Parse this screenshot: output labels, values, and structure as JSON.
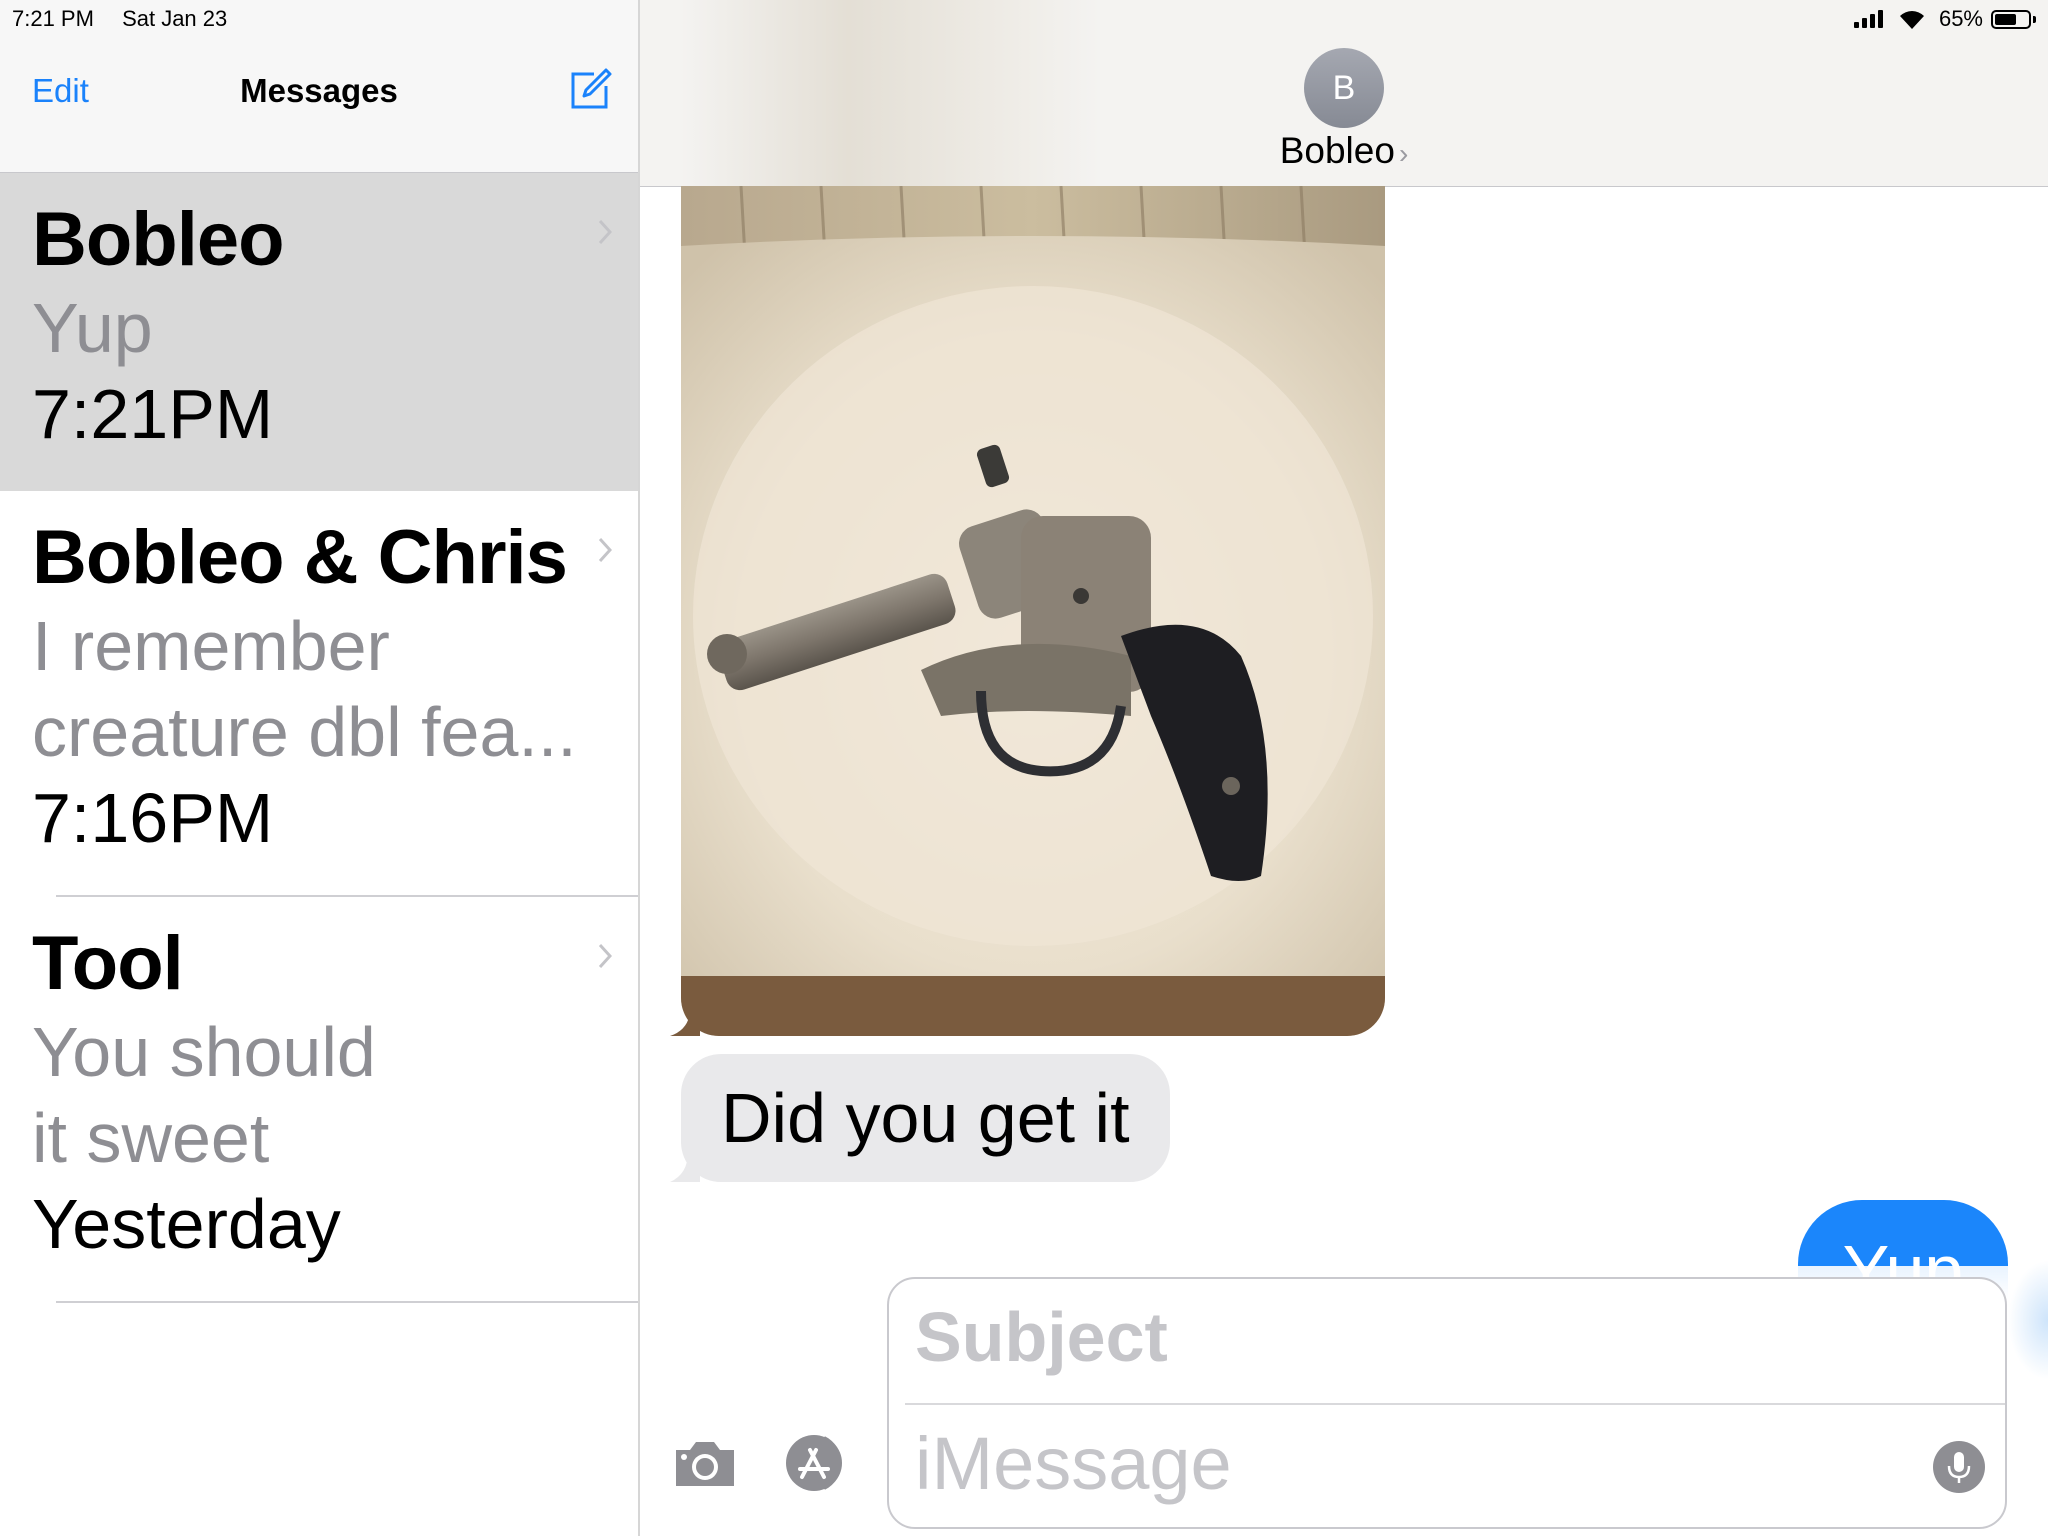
{
  "status_bar": {
    "time": "7:21 PM",
    "date": "Sat Jan 23",
    "battery_text": "65%",
    "battery_level": 0.65
  },
  "sidebar": {
    "edit_label": "Edit",
    "title": "Messages",
    "compose_icon": "compose-icon"
  },
  "conversations": [
    {
      "name": "Bobleo",
      "preview_lines": [
        "Yup"
      ],
      "time": "7:21PM",
      "selected": true
    },
    {
      "name": "Bobleo & Chris",
      "preview_lines": [
        "I remember",
        "creature dbl fea..."
      ],
      "time": "7:16PM",
      "selected": false
    },
    {
      "name": "Tool",
      "preview_lines": [
        "You should",
        "it sweet"
      ],
      "time": "Yesterday",
      "selected": false
    }
  ],
  "chat": {
    "avatar_initial": "B",
    "contact_name": "Bobleo",
    "messages": [
      {
        "type": "photo",
        "direction": "received",
        "content": "revolver-photo"
      },
      {
        "type": "text",
        "direction": "received",
        "text": "Did you get it"
      },
      {
        "type": "text",
        "direction": "sent",
        "text": "Yup"
      }
    ]
  },
  "composer": {
    "subject_placeholder": "Subject",
    "message_placeholder": "iMessage",
    "icons": [
      "camera-icon",
      "app-store-icon",
      "microphone-icon"
    ]
  },
  "colors": {
    "accent": "#1a82fb",
    "sent_bubble": "#1b86fb",
    "received_bubble": "#e9e9eb",
    "selected_row": "#d9d9d9",
    "secondary_text": "#8e8e93"
  }
}
